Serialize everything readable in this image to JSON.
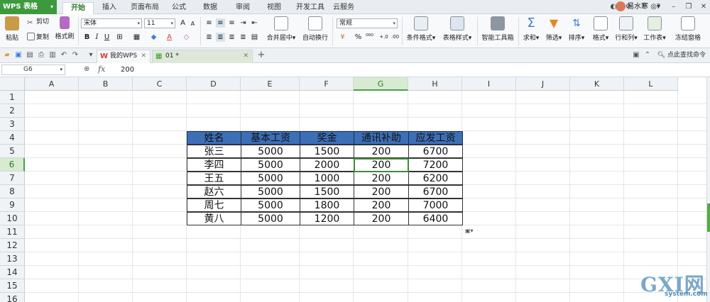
{
  "app": {
    "name": "WPS 表格",
    "user": "易水寒"
  },
  "menu": {
    "tabs": [
      "开始",
      "插入",
      "页面布局",
      "公式",
      "数据",
      "审阅",
      "视图",
      "开发工具",
      "云服务"
    ],
    "active": "开始"
  },
  "ribbon": {
    "paste": "粘贴",
    "cut": "剪切",
    "copy": "复制",
    "format_painter": "格式刷",
    "font_name": "宋体",
    "font_size": "11",
    "merge_center": "合并居中",
    "wrap_text": "自动换行",
    "number_format": "常规",
    "cond_format": "条件格式",
    "table_style": "表格样式",
    "smart_toolbox": "智能工具箱",
    "sum": "求和",
    "filter": "筛选",
    "sort": "排序",
    "format": "格式",
    "row_col": "行和列",
    "worksheet": "工作表",
    "freeze": "冻结窗格"
  },
  "doc_tabs": {
    "my_wps": "我的WPS",
    "current": "01 *",
    "find_placeholder": "点此查找命令"
  },
  "formula_bar": {
    "name_box": "G6",
    "fx": "fx",
    "value": "200"
  },
  "sheet": {
    "columns": [
      "A",
      "B",
      "C",
      "D",
      "E",
      "F",
      "G",
      "H",
      "I",
      "J",
      "K",
      "L"
    ],
    "rows": [
      "1",
      "2",
      "3",
      "4",
      "5",
      "6",
      "7",
      "8",
      "9",
      "10",
      "11",
      "12",
      "13",
      "14",
      "15",
      "16"
    ],
    "selected_col": "G",
    "selected_row": "6",
    "table": {
      "headers": [
        "姓名",
        "基本工资",
        "奖金",
        "通讯补助",
        "应发工资"
      ],
      "rows": [
        [
          "张三",
          "5000",
          "1500",
          "200",
          "6700"
        ],
        [
          "李四",
          "5000",
          "2000",
          "200",
          "7200"
        ],
        [
          "王五",
          "5000",
          "1000",
          "200",
          "6200"
        ],
        [
          "赵六",
          "5000",
          "1500",
          "200",
          "6700"
        ],
        [
          "周七",
          "5000",
          "1800",
          "200",
          "7000"
        ],
        [
          "黄八",
          "5000",
          "1200",
          "200",
          "6400"
        ]
      ],
      "header_color": "#3d6fb7"
    }
  },
  "watermark": {
    "logo": "GXI网",
    "url": "system.com"
  }
}
